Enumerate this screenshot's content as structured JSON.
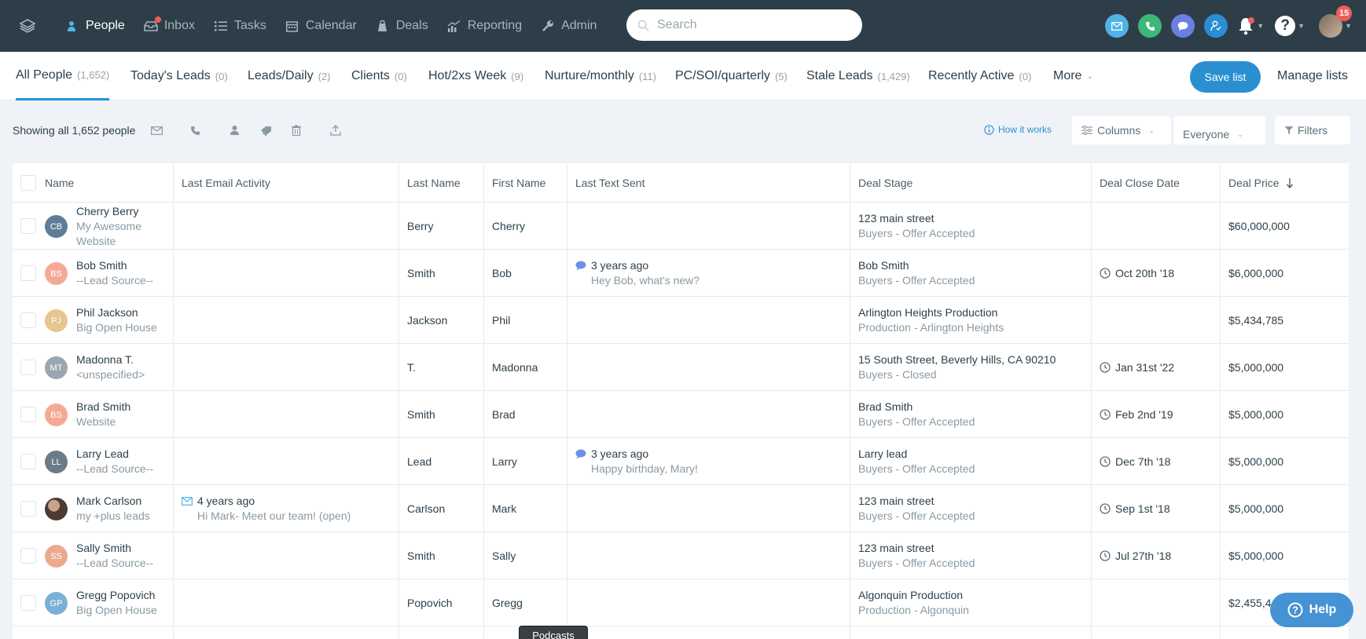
{
  "topnav": {
    "items": [
      {
        "label": "People",
        "icon": "people-icon",
        "active": true
      },
      {
        "label": "Inbox",
        "icon": "inbox-icon",
        "dot": true
      },
      {
        "label": "Tasks",
        "icon": "tasks-icon"
      },
      {
        "label": "Calendar",
        "icon": "calendar-icon"
      },
      {
        "label": "Deals",
        "icon": "deals-icon"
      },
      {
        "label": "Reporting",
        "icon": "reporting-icon"
      },
      {
        "label": "Admin",
        "icon": "admin-icon"
      }
    ],
    "search_placeholder": "Search",
    "notification_count": "15",
    "colors": {
      "bg": "#2d3e49",
      "mail": "#4fb3e8",
      "phone": "#3cb878",
      "chat": "#6c7fe0",
      "contact": "#2a8fd1"
    }
  },
  "lists": {
    "tabs": [
      {
        "label": "All People",
        "count": "(1,652)",
        "active": true
      },
      {
        "label": "Today's Leads",
        "count": "(0)"
      },
      {
        "label": "Leads/Daily",
        "count": "(2)"
      },
      {
        "label": "Clients",
        "count": "(0)"
      },
      {
        "label": "Hot/2xs Week",
        "count": "(9)"
      },
      {
        "label": "Nurture/monthly",
        "count": "(11)"
      },
      {
        "label": "PC/SOI/quarterly",
        "count": "(5)"
      },
      {
        "label": "Stale Leads",
        "count": "(1,429)"
      },
      {
        "label": "Recently Active",
        "count": "(0)"
      },
      {
        "label": "More",
        "count": ""
      }
    ],
    "save_label": "Save list",
    "manage_label": "Manage lists"
  },
  "toolbar": {
    "showing": "Showing all 1,652 people",
    "how_it_works": "How it works",
    "columns_label": "Columns",
    "everyone_label": "Everyone",
    "filters_label": "Filters"
  },
  "table": {
    "headers": {
      "name": "Name",
      "last_email": "Last Email Activity",
      "last_name": "Last Name",
      "first_name": "First Name",
      "last_text": "Last Text Sent",
      "deal_stage": "Deal Stage",
      "deal_close": "Deal Close Date",
      "deal_price": "Deal Price"
    },
    "rows": [
      {
        "initials": "CB",
        "avatar_color": "#5f7d99",
        "name": "Cherry Berry",
        "source": "My Awesome Website",
        "email_time": "",
        "email_text": "",
        "last": "Berry",
        "first": "Cherry",
        "text_time": "",
        "text_msg": "",
        "deal": "123 main street",
        "stage": "Buyers - Offer Accepted",
        "close": "",
        "price": "$60,000,000"
      },
      {
        "initials": "BS",
        "avatar_color": "#f4a996",
        "name": "Bob Smith",
        "source": "--Lead Source--",
        "email_time": "",
        "email_text": "",
        "last": "Smith",
        "first": "Bob",
        "text_time": "3 years ago",
        "text_msg": "Hey Bob, what's new?",
        "deal": "Bob Smith",
        "stage": "Buyers - Offer Accepted",
        "close": "Oct 20th '18",
        "price": "$6,000,000"
      },
      {
        "initials": "PJ",
        "avatar_color": "#e6c58e",
        "name": "Phil Jackson",
        "source": "Big Open House",
        "email_time": "",
        "email_text": "",
        "last": "Jackson",
        "first": "Phil",
        "text_time": "",
        "text_msg": "",
        "deal": "Arlington Heights Production",
        "stage": "Production - Arlington Heights",
        "close": "",
        "price": "$5,434,785"
      },
      {
        "initials": "MT",
        "avatar_color": "#9aa6b2",
        "name": "Madonna T.",
        "source": "<unspecified>",
        "email_time": "",
        "email_text": "",
        "last": "T.",
        "first": "Madonna",
        "text_time": "",
        "text_msg": "",
        "deal": "15 South Street, Beverly Hills, CA 90210",
        "stage": "Buyers - Closed",
        "close": "Jan 31st '22",
        "price": "$5,000,000"
      },
      {
        "initials": "BS",
        "avatar_color": "#f4a996",
        "name": "Brad Smith",
        "source": "Website",
        "email_time": "",
        "email_text": "",
        "last": "Smith",
        "first": "Brad",
        "text_time": "",
        "text_msg": "",
        "deal": "Brad Smith",
        "stage": "Buyers - Offer Accepted",
        "close": "Feb 2nd '19",
        "price": "$5,000,000"
      },
      {
        "initials": "LL",
        "avatar_color": "#6a7b89",
        "name": "Larry Lead",
        "source": "--Lead Source--",
        "email_time": "",
        "email_text": "",
        "last": "Lead",
        "first": "Larry",
        "text_time": "3 years ago",
        "text_msg": "Happy birthday, Mary!",
        "deal": "Larry lead",
        "stage": "Buyers - Offer Accepted",
        "close": "Dec 7th '18",
        "price": "$5,000,000"
      },
      {
        "initials": "",
        "avatar_color": "#4a3b33",
        "name": "Mark Carlson",
        "source": "my +plus leads",
        "email_time": "4 years ago",
        "email_text": "Hi Mark- Meet our team! (open)",
        "last": "Carlson",
        "first": "Mark",
        "text_time": "",
        "text_msg": "",
        "deal": "123 main street",
        "stage": "Buyers - Offer Accepted",
        "close": "Sep 1st '18",
        "price": "$5,000,000"
      },
      {
        "initials": "SS",
        "avatar_color": "#ebaa8e",
        "name": "Sally Smith",
        "source": "--Lead Source--",
        "email_time": "",
        "email_text": "",
        "last": "Smith",
        "first": "Sally",
        "text_time": "",
        "text_msg": "",
        "deal": "123 main street",
        "stage": "Buyers - Offer Accepted",
        "close": "Jul 27th '18",
        "price": "$5,000,000"
      },
      {
        "initials": "GP",
        "avatar_color": "#7ab1d6",
        "name": "Gregg Popovich",
        "source": "Big Open House",
        "email_time": "",
        "email_text": "",
        "last": "Popovich",
        "first": "Gregg",
        "text_time": "",
        "text_msg": "",
        "deal": "Algonquin Production",
        "stage": "Production - Algonquin",
        "close": "",
        "price": "$2,455,4"
      }
    ]
  },
  "help_label": "Help",
  "podcasts_label": "Podcasts"
}
